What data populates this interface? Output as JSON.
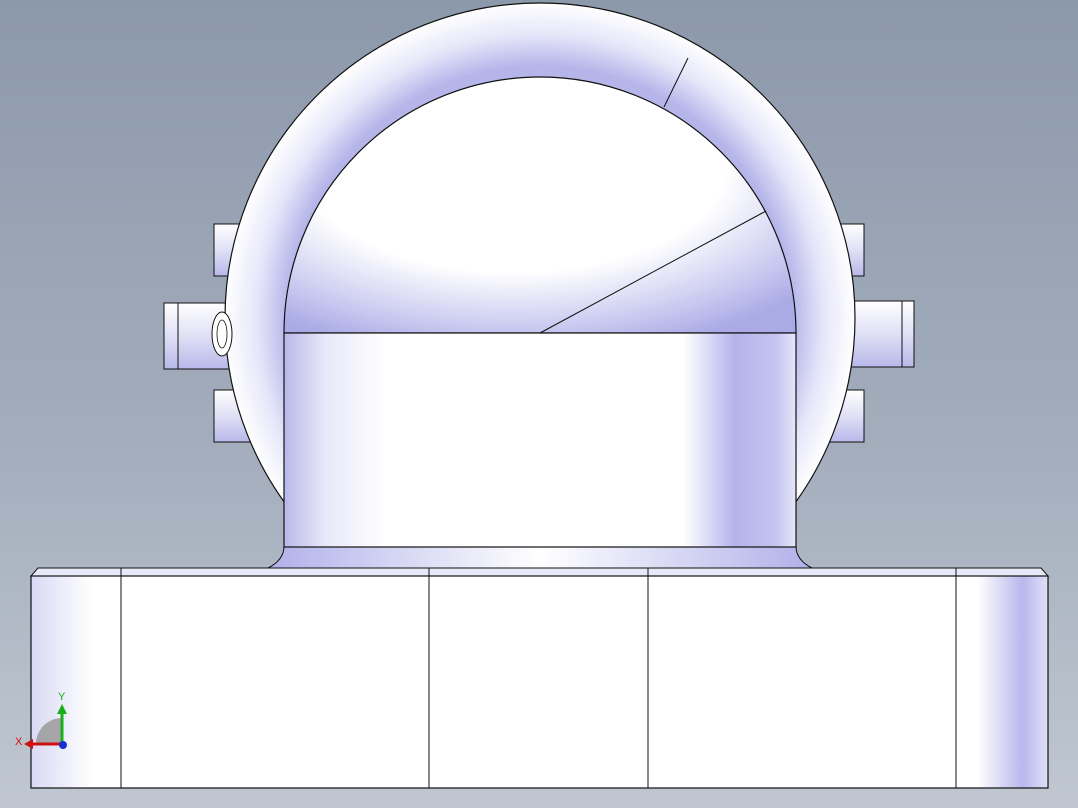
{
  "viewport": {
    "model": "pillow-block-bearing-housing",
    "view": "front"
  },
  "triad": {
    "x_label": "X",
    "y_label": "Y",
    "colors": {
      "x": "#d01010",
      "y": "#18b018",
      "z": "#1530d0"
    }
  },
  "colors": {
    "background_top": "#8c99ab",
    "background_bottom": "#c0c7d1",
    "edge": "#111111",
    "shade": "#a6a6e6",
    "highlight": "#ffffff"
  }
}
